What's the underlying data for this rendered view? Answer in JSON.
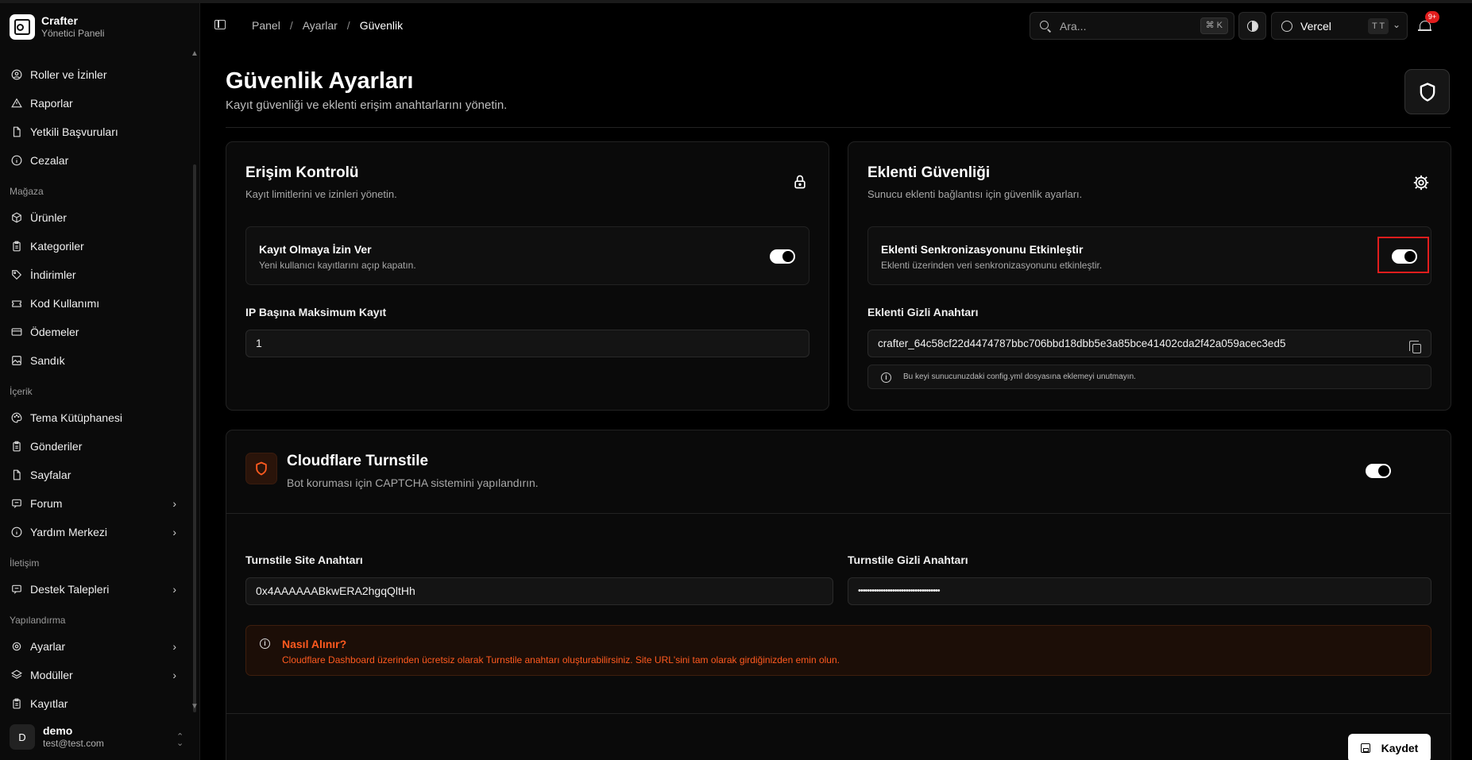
{
  "brand": {
    "name": "Crafter",
    "subtitle": "Yönetici Paneli"
  },
  "sidebar": {
    "items": [
      {
        "type": "item",
        "label": "Roller ve İzinler",
        "icon": "user-circle-icon"
      },
      {
        "type": "item",
        "label": "Raporlar",
        "icon": "warning-triangle-icon"
      },
      {
        "type": "item",
        "label": "Yetkili Başvuruları",
        "icon": "file-icon"
      },
      {
        "type": "item",
        "label": "Cezalar",
        "icon": "info-circle-icon"
      },
      {
        "type": "group",
        "label": "Mağaza"
      },
      {
        "type": "item",
        "label": "Ürünler",
        "icon": "box-icon"
      },
      {
        "type": "item",
        "label": "Kategoriler",
        "icon": "clipboard-icon"
      },
      {
        "type": "item",
        "label": "İndirimler",
        "icon": "tag-icon"
      },
      {
        "type": "item",
        "label": "Kod Kullanımı",
        "icon": "ticket-icon"
      },
      {
        "type": "item",
        "label": "Ödemeler",
        "icon": "credit-card-icon"
      },
      {
        "type": "item",
        "label": "Sandık",
        "icon": "image-icon"
      },
      {
        "type": "group",
        "label": "İçerik"
      },
      {
        "type": "item",
        "label": "Tema Kütüphanesi",
        "icon": "palette-icon"
      },
      {
        "type": "item",
        "label": "Gönderiler",
        "icon": "clipboard-icon"
      },
      {
        "type": "item",
        "label": "Sayfalar",
        "icon": "file-icon"
      },
      {
        "type": "item",
        "label": "Forum",
        "icon": "message-icon",
        "chevron": true
      },
      {
        "type": "item",
        "label": "Yardım Merkezi",
        "icon": "info-circle-icon",
        "chevron": true
      },
      {
        "type": "group",
        "label": "İletişim"
      },
      {
        "type": "item",
        "label": "Destek Talepleri",
        "icon": "message-icon",
        "chevron": true
      },
      {
        "type": "group",
        "label": "Yapılandırma"
      },
      {
        "type": "item",
        "label": "Ayarlar",
        "icon": "gear-icon",
        "chevron": true
      },
      {
        "type": "item",
        "label": "Modüller",
        "icon": "layers-icon",
        "chevron": true
      },
      {
        "type": "item",
        "label": "Kayıtlar",
        "icon": "clipboard-icon"
      }
    ]
  },
  "user": {
    "initial": "D",
    "name": "demo",
    "email": "test@test.com"
  },
  "header": {
    "breadcrumb": [
      "Panel",
      "Ayarlar",
      "Güvenlik"
    ],
    "search_placeholder": "Ara...",
    "search_shortcut": "⌘ K",
    "theme_name": "Vercel",
    "theme_badge": "T T",
    "notification_count": "9+"
  },
  "page": {
    "title": "Güvenlik Ayarları",
    "subtitle": "Kayıt güvenliği ve eklenti erişim anahtarlarını yönetin."
  },
  "access_card": {
    "title": "Erişim Kontrolü",
    "subtitle": "Kayıt limitlerini ve izinleri yönetin.",
    "toggle_title": "Kayıt Olmaya İzin Ver",
    "toggle_desc": "Yeni kullanıcı kayıtlarını açıp kapatın.",
    "toggle_on": true,
    "max_label": "IP Başına Maksimum Kayıt",
    "max_value": "1"
  },
  "plugin_card": {
    "title": "Eklenti Güvenliği",
    "subtitle": "Sunucu eklenti bağlantısı için güvenlik ayarları.",
    "toggle_title": "Eklenti Senkronizasyonunu Etkinleştir",
    "toggle_desc": "Eklenti üzerinden veri senkronizasyonunu etkinleştir.",
    "toggle_on": true,
    "secret_label": "Eklenti Gizli Anahtarı",
    "secret_value": "crafter_64c58cf22d4474787bbc706bbd18dbb5e3a85bce41402cda2f42a059acec3ed5",
    "note": "Bu keyi sunucunuzdaki config.yml dosyasına eklemeyi unutmayın."
  },
  "turnstile": {
    "title": "Cloudflare Turnstile",
    "subtitle": "Bot koruması için CAPTCHA sistemini yapılandırın.",
    "enabled": true,
    "site_key_label": "Turnstile Site Anahtarı",
    "site_key_value": "0x4AAAAAABkwERA2hgqQltHh",
    "secret_key_label": "Turnstile Gizli Anahtarı",
    "secret_key_value": "••••••••••••••••••••••••••••••••••••",
    "warn_title": "Nasıl Alınır?",
    "warn_text": "Cloudflare Dashboard üzerinden ücretsiz olarak Turnstile anahtarı oluşturabilirsiniz. Site URL'sini tam olarak girdiğinizden emin olun.",
    "save_label": "Kaydet"
  },
  "colors": {
    "accent": "#ff5a1f",
    "highlight": "#e11d1d",
    "background": "#000000"
  }
}
